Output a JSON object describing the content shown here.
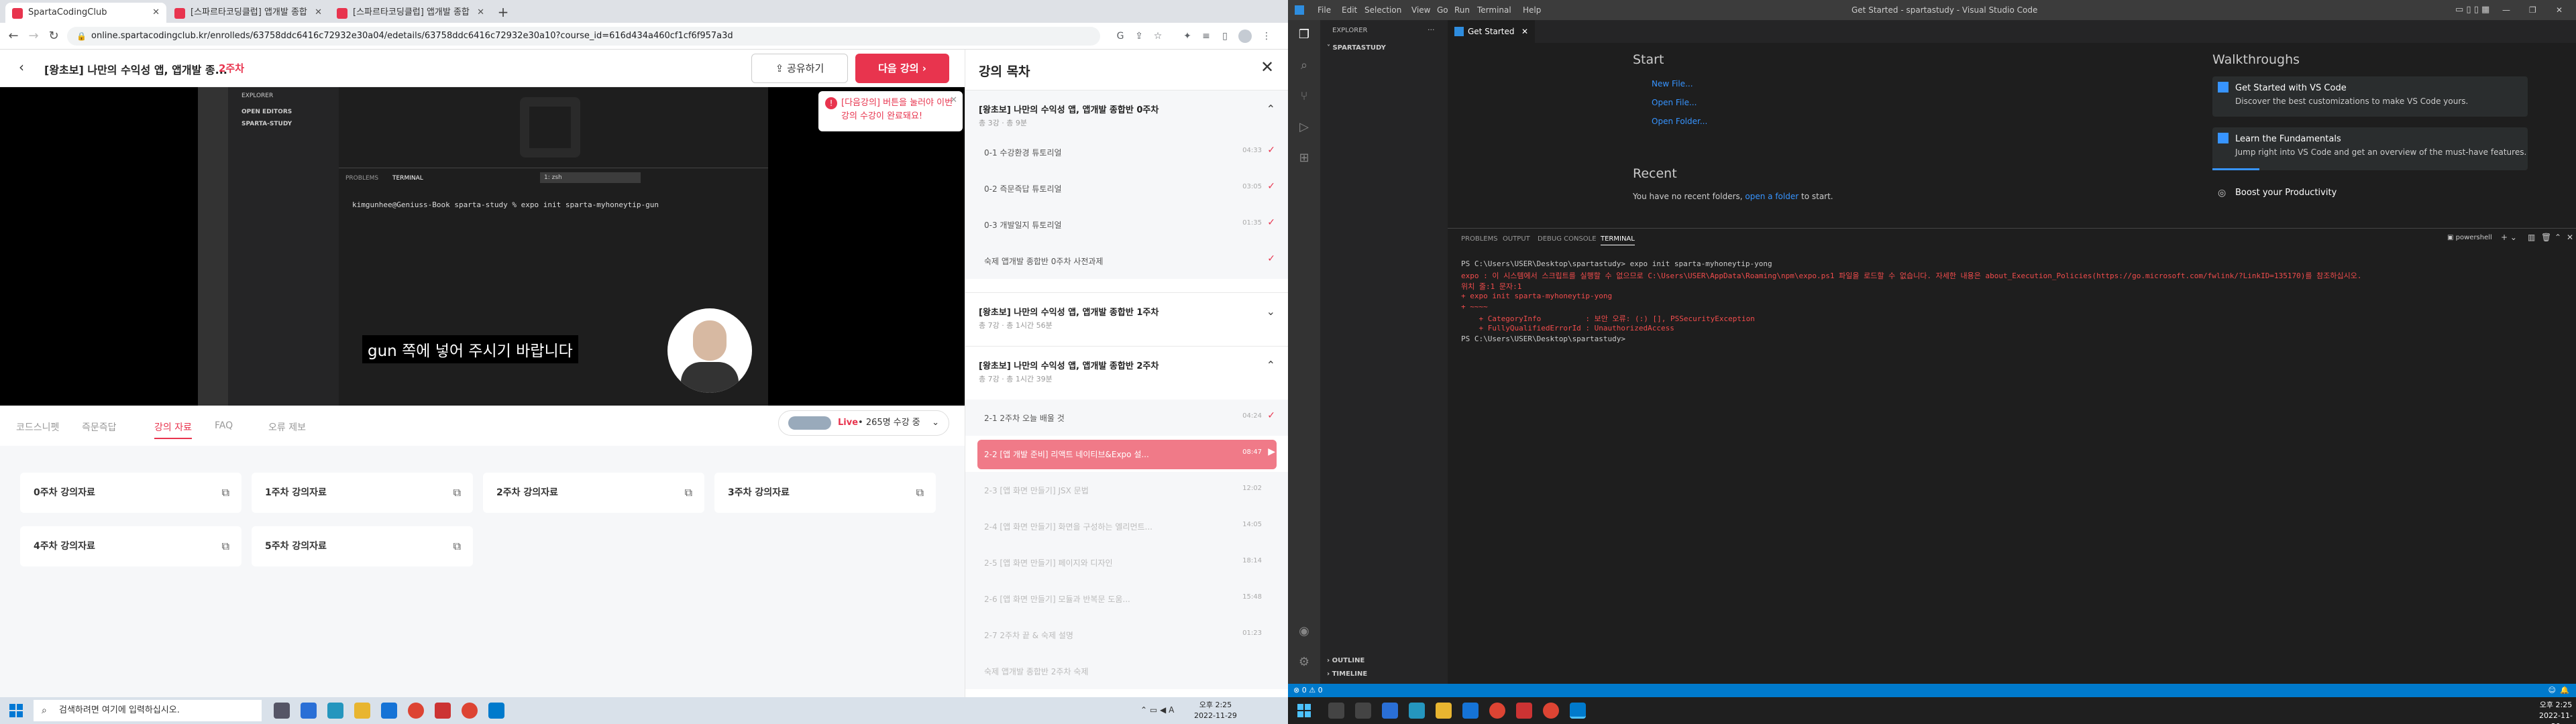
{
  "browser": {
    "tabs": [
      {
        "label": "SpartaCodingClub"
      },
      {
        "label": "[스파르타코딩클럽] 앱개발 종합"
      },
      {
        "label": "[스파르타코딩클럽] 앱개발 종합"
      }
    ],
    "new_tab": "+",
    "url": "online.spartacodingclub.kr/enrolleds/63758ddc6416c72932e30a04/edetails/63758ddc6416c72932e30a10?course_id=616d434a460cf1cf6f957a3d"
  },
  "page": {
    "lecture_title": "[왕초보] 나만의 수익성 앱, 앱개발 종...",
    "week_label": "2주차",
    "share_label": "공유하기",
    "next_label": "다음 강의",
    "notice": "[다음강의] 버튼을 눌러야 이번 강의 수강이 완료돼요!",
    "video": {
      "explorer_label": "EXPLORER",
      "open_editors": "OPEN EDITORS",
      "folder": "SPARTA-STUDY",
      "panel_tabs": [
        "PROBLEMS",
        "TERMINAL"
      ],
      "shell": "1: zsh",
      "prompt": "kimgunhee@Geniuss-Book sparta-study % expo init sparta-myhoneytip-gun",
      "subtitle": "gun 쪽에 넣어 주시기 바랍니다"
    },
    "subtabs": [
      "코드스니펫",
      "즉문즉답",
      "강의 자료",
      "FAQ",
      "오류 제보"
    ],
    "live": {
      "prefix": "Live",
      "text": "265명 수강 중"
    },
    "materials": [
      "0주차 강의자료",
      "1주차 강의자료",
      "2주차 강의자료",
      "3주차 강의자료",
      "4주차 강의자료",
      "5주차 강의자료"
    ]
  },
  "toc": {
    "title": "강의 목차",
    "weeks": [
      {
        "title": "[왕초보] 나만의 수익성 앱, 앱개발 종합반 0주차",
        "meta": "총 3강 · 총 9분"
      },
      {
        "title": "[왕초보] 나만의 수익성 앱, 앱개발 종합반 1주차",
        "meta": "총 7강 · 총 1시간 56분"
      },
      {
        "title": "[왕초보] 나만의 수익성 앱, 앱개발 종합반 2주차",
        "meta": "총 7강 · 총 1시간 39분"
      }
    ],
    "week0_items": [
      {
        "title": "0-1  수강환경 튜토리얼",
        "dur": "04:33"
      },
      {
        "title": "0-2  즉문즉답 튜토리얼",
        "dur": "03:05"
      },
      {
        "title": "0-3  개발일지 튜토리얼",
        "dur": "01:35"
      },
      {
        "title": "숙제  앱개발 종합반 0주차 사전과제",
        "dur": ""
      }
    ],
    "week2_items": [
      {
        "title": "2-1  2주차 오늘 배울 것",
        "dur": "04:24"
      },
      {
        "title": "2-2  [앱 개발 준비] 리액트 네이티브&Expo 설...",
        "dur": "08:47"
      },
      {
        "title": "2-3  [앱 화면 만들기] JSX 문법",
        "dur": "12:02"
      },
      {
        "title": "2-4  [앱 화면 만들기] 화면을 구성하는 엘리먼트...",
        "dur": "14:05"
      },
      {
        "title": "2-5  [앱 화면 만들기] 페이지와 디자인",
        "dur": "18:14"
      },
      {
        "title": "2-6  [앱 화면 만들기] 모듈과 반복문 도움...",
        "dur": "15:48"
      },
      {
        "title": "2-7  2주차 끝 & 숙제 설명",
        "dur": "01:23"
      },
      {
        "title": "숙제  앱개발 종합반 2주차 숙제",
        "dur": ""
      }
    ]
  },
  "left_taskbar": {
    "search_placeholder": "검색하려면 여기에 입력하십시오.",
    "time": "오후 2:25",
    "date": "2022-11-29"
  },
  "vscode": {
    "menu": [
      "File",
      "Edit",
      "Selection",
      "View",
      "Go",
      "Run",
      "Terminal",
      "Help"
    ],
    "title": "Get Started - spartastudy - Visual Studio Code",
    "explorer_label": "EXPLORER",
    "folder": "SPARTASTUDY",
    "outline": "OUTLINE",
    "timeline": "TIMELINE",
    "editor_tab": "Get Started",
    "start": {
      "heading": "Start",
      "links": [
        "New File...",
        "Open File...",
        "Open Folder..."
      ]
    },
    "recent": {
      "heading": "Recent",
      "text_prefix": "You have no recent folders,",
      "link": "open a folder",
      "text_suffix": "to start."
    },
    "walkthroughs": {
      "heading": "Walkthroughs",
      "items": [
        {
          "title": "Get Started with VS Code",
          "desc": "Discover the best customizations to make VS Code yours."
        },
        {
          "title": "Learn the Fundamentals",
          "desc": "Jump right into VS Code and get an overview of the must-have features."
        },
        {
          "title": "Boost your Productivity",
          "desc": ""
        }
      ]
    },
    "panel_tabs": [
      "PROBLEMS",
      "OUTPUT",
      "DEBUG CONSOLE",
      "TERMINAL"
    ],
    "shell": "powershell",
    "terminal_lines": [
      {
        "text": "PS C:\\Users\\USER\\Desktop\\spartastudy> expo init sparta-myhoneytip-yong",
        "color": "#cccccc"
      },
      {
        "text": "expo : 이 시스템에서 스크립트를 실행할 수 없으므로 C:\\Users\\USER\\AppData\\Roaming\\npm\\expo.ps1 파일을 로드할 수 없습니다. 자세한 내용은 about_Execution_Policies(https://go.microsoft.com/fwlink/?LinkID=135170)를 참조하십시오.",
        "color": "#f14c4c"
      },
      {
        "text": "위치 줄:1 문자:1",
        "color": "#f14c4c"
      },
      {
        "text": "+ expo init sparta-myhoneytip-yong",
        "color": "#f14c4c"
      },
      {
        "text": "+ ~~~~",
        "color": "#f14c4c"
      },
      {
        "text": "    + CategoryInfo          : 보안 오류: (:) [], PSSecurityException",
        "color": "#f14c4c"
      },
      {
        "text": "    + FullyQualifiedErrorId : UnauthorizedAccess",
        "color": "#f14c4c"
      },
      {
        "text": "PS C:\\Users\\USER\\Desktop\\spartastudy> ",
        "color": "#cccccc"
      }
    ],
    "status": "⊗ 0 ⚠ 0"
  },
  "right_taskbar": {
    "time": "오후 2:25",
    "date": "2022-11-29"
  },
  "colors": {
    "accent": "#e8344e",
    "vscode_blue": "#007acc"
  }
}
